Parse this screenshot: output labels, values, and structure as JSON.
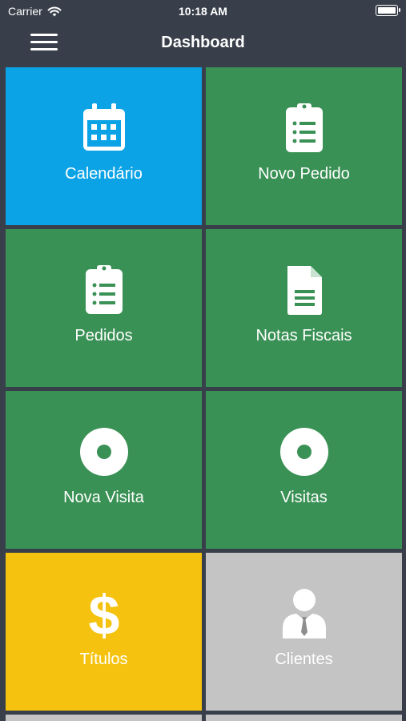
{
  "status_bar": {
    "carrier": "Carrier",
    "time": "10:18 AM"
  },
  "nav": {
    "title": "Dashboard"
  },
  "tiles": [
    {
      "label": "Calendário",
      "icon": "calendar-icon",
      "color": "#0ca3e6"
    },
    {
      "label": "Novo Pedido",
      "icon": "clipboard-list-icon",
      "color": "#3a9155"
    },
    {
      "label": "Pedidos",
      "icon": "clipboard-list-icon",
      "color": "#3a9155"
    },
    {
      "label": "Notas Fiscais",
      "icon": "document-icon",
      "color": "#3a9155"
    },
    {
      "label": "Nova Visita",
      "icon": "disc-icon",
      "color": "#3a9155"
    },
    {
      "label": "Visitas",
      "icon": "disc-icon",
      "color": "#3a9155"
    },
    {
      "label": "Títulos",
      "icon": "dollar-icon",
      "color": "#f5c30f"
    },
    {
      "label": "Clientes",
      "icon": "user-tie-icon",
      "color": "#c4c4c4"
    }
  ]
}
